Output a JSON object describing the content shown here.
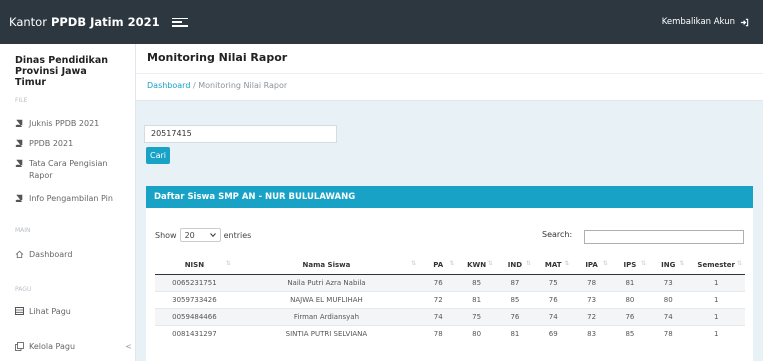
{
  "topbar": {
    "brand_prefix": "Kantor",
    "brand_bold": "PPDB Jatim 2021",
    "account_label": "Kembalikan Akun"
  },
  "sidebar": {
    "org_line1": "Dinas Pendidikan",
    "org_line2": "Provinsi Jawa Timur",
    "section_file": "FILE",
    "items": [
      {
        "label": "Juknis PPDB 2021"
      },
      {
        "label": "PPDB 2021"
      },
      {
        "label": "Tata Cara Pengisian Rapor"
      },
      {
        "label": "Info Pengambilan Pin"
      }
    ],
    "section_main": "MAIN",
    "dashboard_label": "Dashboard",
    "section_pagu": "PAGU",
    "lihat_pagu_label": "Lihat Pagu",
    "kelola_pagu_label": "Kelola Pagu",
    "kelola_chevron": "<"
  },
  "page": {
    "title": "Monitoring Nilai Rapor",
    "breadcrumb_home": "Dashboard",
    "breadcrumb_sep": "/",
    "breadcrumb_current": "Monitoring Nilai Rapor"
  },
  "search": {
    "value": "20517415",
    "button_label": "Cari"
  },
  "card": {
    "title": "Daftar Siswa SMP AN - NUR BULULAWANG",
    "show_label": "Show",
    "entries_value": "20",
    "entries_label": "entries",
    "search_label": "Search:",
    "headers": [
      "NISN",
      "Nama Siswa",
      "PA",
      "KWN",
      "IND",
      "MAT",
      "IPA",
      "IPS",
      "ING",
      "Semester"
    ],
    "rows": [
      [
        "0065231751",
        "Naila Putri Azra Nabila",
        "76",
        "85",
        "87",
        "75",
        "78",
        "81",
        "73",
        "1"
      ],
      [
        "3059733426",
        "NAJWA EL MUFLIHAH",
        "72",
        "81",
        "85",
        "76",
        "73",
        "80",
        "80",
        "1"
      ],
      [
        "0059484466",
        "Firman Ardiansyah",
        "74",
        "75",
        "76",
        "74",
        "72",
        "76",
        "74",
        "1"
      ],
      [
        "0081431297",
        "SINTIA PUTRI SELVIANA",
        "78",
        "80",
        "81",
        "69",
        "83",
        "85",
        "78",
        "1"
      ]
    ]
  }
}
